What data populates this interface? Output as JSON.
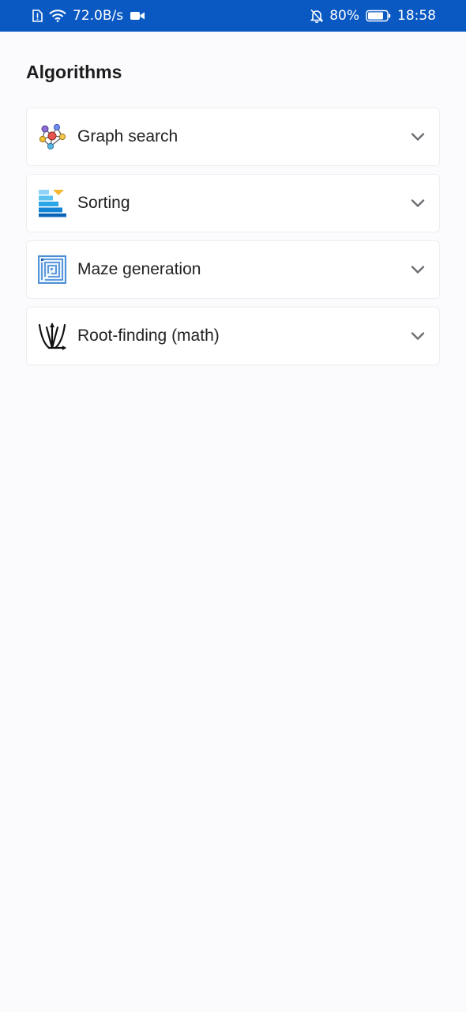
{
  "status_bar": {
    "network_speed": "72.0B/s",
    "battery_percent": "80%",
    "time": "18:58"
  },
  "page": {
    "title": "Algorithms"
  },
  "algorithms": {
    "items": [
      {
        "label": "Graph search",
        "icon": "graph-network-icon"
      },
      {
        "label": "Sorting",
        "icon": "sorting-bars-icon"
      },
      {
        "label": "Maze generation",
        "icon": "maze-icon"
      },
      {
        "label": "Root-finding (math)",
        "icon": "root-finding-icon"
      }
    ]
  },
  "colors": {
    "status_bar_bg": "#0a59c3",
    "page_bg": "#fbfbfd",
    "card_bg": "#ffffff",
    "card_border": "#eeeef1",
    "chevron": "#6d6d73"
  }
}
